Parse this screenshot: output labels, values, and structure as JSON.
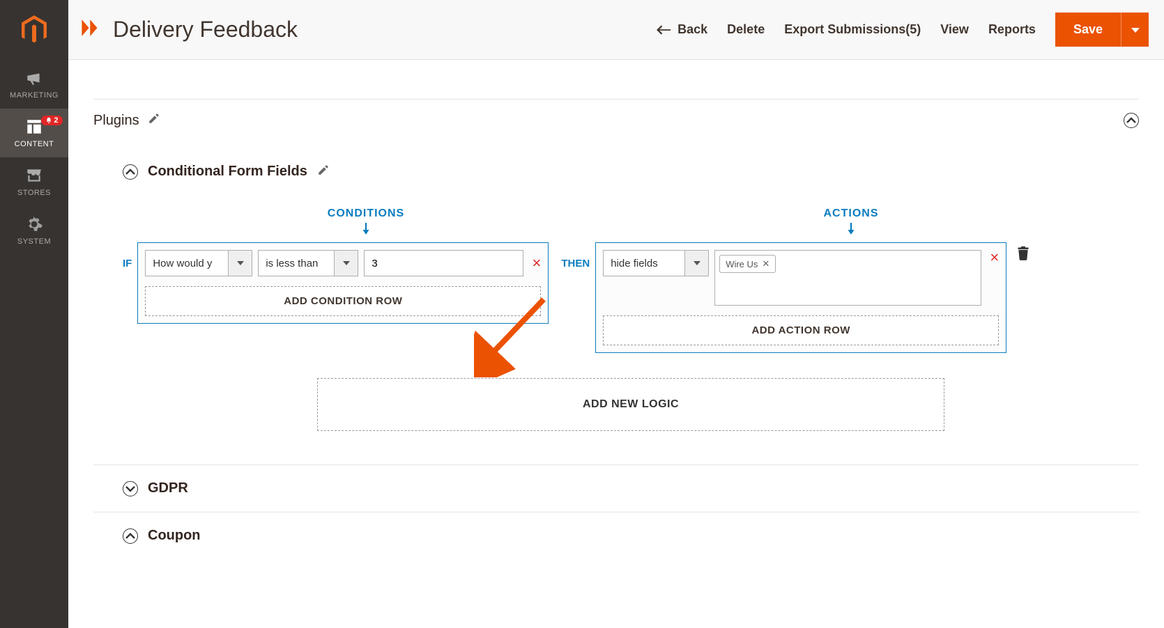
{
  "sidebar": {
    "items": [
      {
        "label": "MARKETING"
      },
      {
        "label": "CONTENT",
        "badge": "2",
        "active": true
      },
      {
        "label": "STORES"
      },
      {
        "label": "SYSTEM"
      }
    ]
  },
  "header": {
    "title": "Delivery Feedback",
    "back": "Back",
    "delete": "Delete",
    "export": "Export Submissions(5)",
    "view": "View",
    "reports": "Reports",
    "save": "Save"
  },
  "plugins": {
    "title": "Plugins"
  },
  "conditional": {
    "title": "Conditional Form Fields",
    "conditions_label": "CONDITIONS",
    "actions_label": "ACTIONS",
    "if": "IF",
    "then": "THEN",
    "field_select": "How would y",
    "operator": "is less than",
    "value": "3",
    "action_select": "hide fields",
    "tag": "Wire Us",
    "add_condition": "ADD CONDITION ROW",
    "add_action": "ADD ACTION ROW",
    "add_logic": "ADD NEW LOGIC"
  },
  "accordions": {
    "gdpr": "GDPR",
    "coupon": "Coupon"
  }
}
